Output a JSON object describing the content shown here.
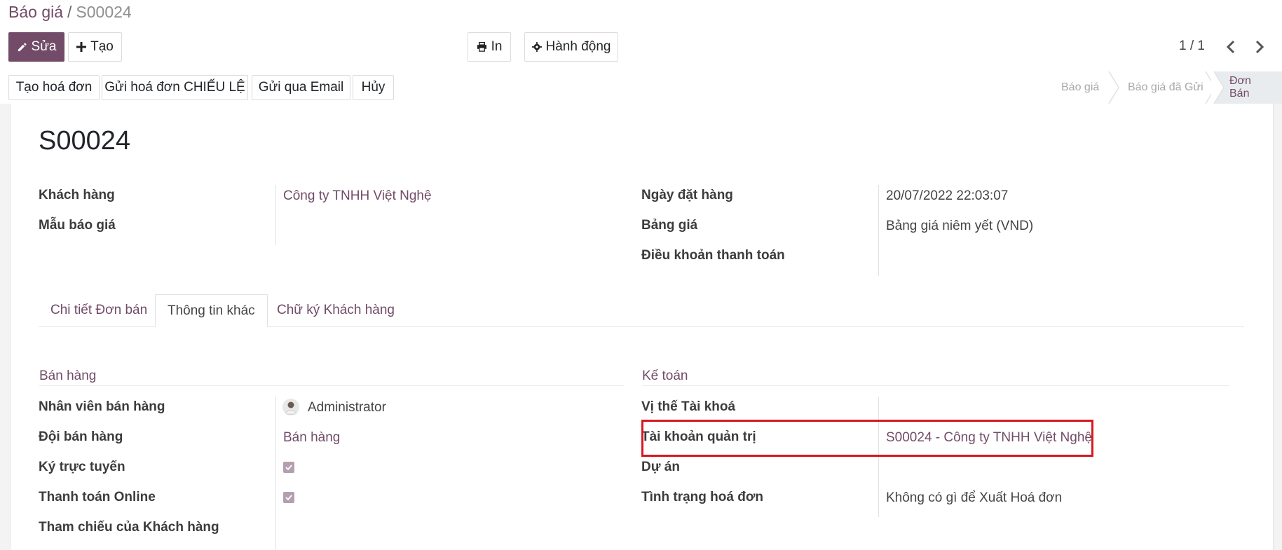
{
  "breadcrumb": {
    "parent": "Báo giá",
    "separator": "/",
    "current": "S00024"
  },
  "toolbar": {
    "edit_label": "Sửa",
    "create_label": "Tạo",
    "print_label": "In",
    "action_label": "Hành động"
  },
  "pager": {
    "value": "1 / 1"
  },
  "status_buttons": {
    "create_invoice": "Tạo hoá đơn",
    "send_proforma": "Gửi hoá đơn CHIẾU LỆ",
    "send_email": "Gửi qua Email",
    "cancel": "Hủy"
  },
  "stages": {
    "quotation": "Báo giá",
    "quotation_sent": "Báo giá đã Gửi",
    "sales_order": "Đơn Bán"
  },
  "record": {
    "title": "S00024",
    "customer_label": "Khách hàng",
    "customer_value": "Công ty TNHH Việt Nghệ",
    "template_label": "Mẫu báo giá",
    "order_date_label": "Ngày đặt hàng",
    "order_date_value": "20/07/2022 22:03:07",
    "pricelist_label": "Bảng giá",
    "pricelist_value": "Bảng giá niêm yết (VND)",
    "payment_terms_label": "Điều khoản thanh toán"
  },
  "tabs": {
    "order_lines": "Chi tiết Đơn bán",
    "other_info": "Thông tin khác",
    "signature": "Chữ ký Khách hàng"
  },
  "sales_section": {
    "title": "Bán hàng",
    "salesperson_label": "Nhân viên bán hàng",
    "salesperson_value": "Administrator",
    "team_label": "Đội bán hàng",
    "team_value": "Bán hàng",
    "online_sign_label": "Ký trực tuyến",
    "online_pay_label": "Thanh toán Online",
    "customer_ref_label": "Tham chiếu của Khách hàng"
  },
  "accounting_section": {
    "title": "Kế toán",
    "fiscal_position_label": "Vị thế Tài khoá",
    "analytic_account_label": "Tài khoản quản trị",
    "analytic_account_value": "S00024 - Công ty TNHH Việt Nghệ",
    "project_label": "Dự án",
    "invoice_status_label": "Tình trạng hoá đơn",
    "invoice_status_value": "Không có gì để Xuất Hoá đơn"
  },
  "colors": {
    "brand": "#714b67",
    "highlight": "#d7181f"
  }
}
